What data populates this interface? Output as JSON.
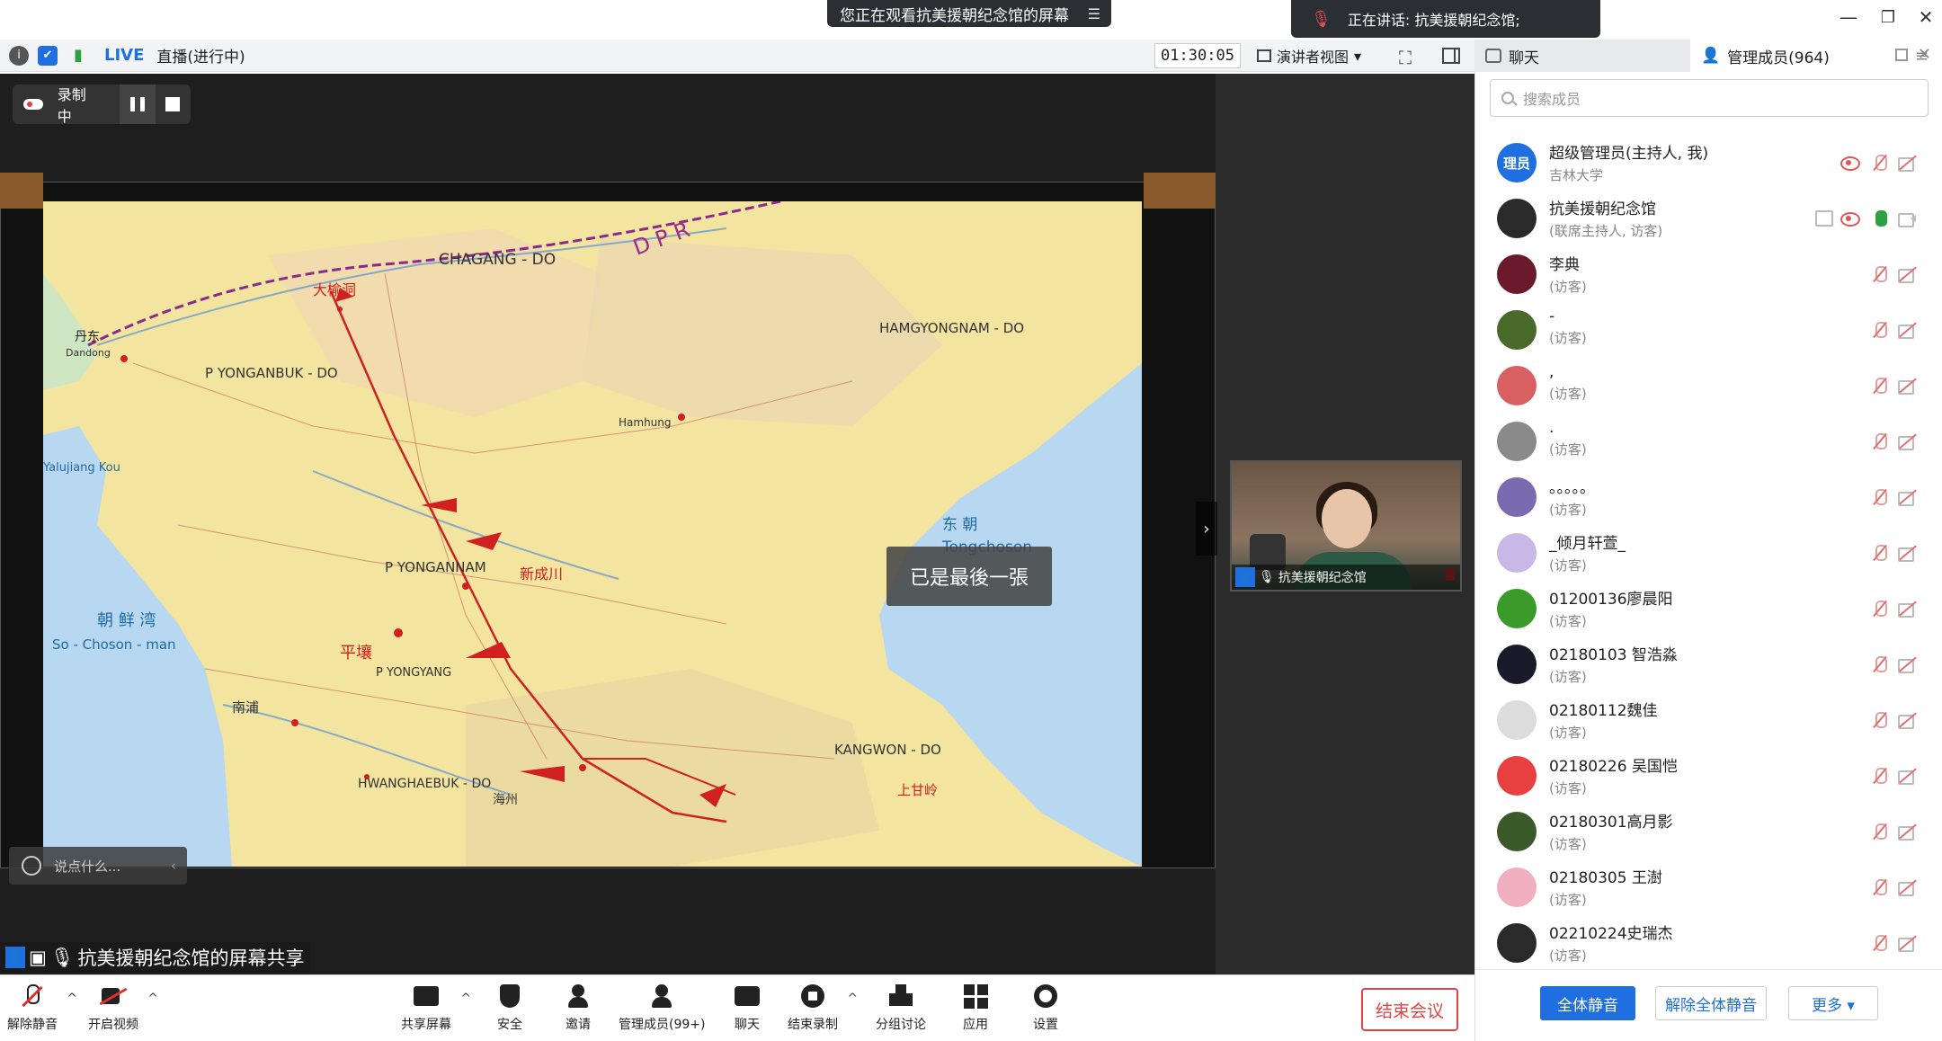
{
  "window": {
    "viewing_banner": "您正在观看抗美援朝纪念馆的屏幕",
    "speaking": "正在讲话: 抗美援朝纪念馆;",
    "min": "—",
    "restore": "❐",
    "close": "✕"
  },
  "statusbar": {
    "live": "LIVE",
    "live_status": "直播(进行中)",
    "timer": "01:30:05",
    "view_mode": "演讲者视图"
  },
  "panel_tabs": {
    "chat": "聊天",
    "members": "管理成员(964)"
  },
  "recording": {
    "label": "录制中"
  },
  "share": {
    "toast": "已是最後一張",
    "chat_placeholder": "说点什么...",
    "share_label": "抗美援朝纪念馆的屏幕共享"
  },
  "video_tile": {
    "name": "抗美援朝纪念馆"
  },
  "map_labels": {
    "dandong": "丹东",
    "dandong_en": "Dandong",
    "chagang": "CHAGANG - DO",
    "dpr": "D P R",
    "yonganbuk": "P YONGANBUK - DO",
    "hamgyongnam": "HAMGYONGNAM - DO",
    "pyongannam": "P YONGANNAM",
    "sojosonman": "So - Choson - man",
    "pyongyang": "P YONGYANG",
    "hwanghaebuk": "HWANGHAEBUK - DO",
    "kangwon": "KANGWON - DO",
    "tongchoson": "Tongchoson",
    "yalujiang": "Yalujiang Kou",
    "hamhung": "Hamhung",
    "chosen_bay": "朝 鲜 湾",
    "east": "东    朝",
    "sinanju": "新成川",
    "dayudong": "大榆洞",
    "pingrang": "平壤",
    "shangganling": "上甘岭",
    "nampo": "南浦",
    "haeju": "海州"
  },
  "members": {
    "search_placeholder": "搜索成员",
    "list": [
      {
        "name": "超级管理员(主持人, 我)",
        "role": "吉林大学",
        "avatar_text": "理员",
        "avatar_color": "#1f6fe0",
        "share": false,
        "rec": true,
        "mic_on": false
      },
      {
        "name": "抗美援朝纪念馆",
        "role": "(联席主持人, 访客)",
        "avatar_text": "",
        "avatar_color": "#2a2a2a",
        "share": true,
        "rec": true,
        "mic_on": true
      },
      {
        "name": "李典",
        "role": "(访客)",
        "avatar_text": "",
        "avatar_color": "#6a1a2a",
        "share": false,
        "rec": false,
        "mic_on": false
      },
      {
        "name": "-",
        "role": "(访客)",
        "avatar_text": "",
        "avatar_color": "#4a6a2a",
        "share": false,
        "rec": false,
        "mic_on": false
      },
      {
        "name": ",",
        "role": "(访客)",
        "avatar_text": "",
        "avatar_color": "#d86060",
        "share": false,
        "rec": false,
        "mic_on": false
      },
      {
        "name": ".",
        "role": "(访客)",
        "avatar_text": "",
        "avatar_color": "#8a8a8a",
        "share": false,
        "rec": false,
        "mic_on": false
      },
      {
        "name": "。。。。。",
        "role": "(访客)",
        "avatar_text": "",
        "avatar_color": "#7a6ab0",
        "share": false,
        "rec": false,
        "mic_on": false
      },
      {
        "name": "_倾月轩萱_",
        "role": "(访客)",
        "avatar_text": "",
        "avatar_color": "#c8b8e8",
        "share": false,
        "rec": false,
        "mic_on": false
      },
      {
        "name": "01200136廖晨阳",
        "role": "(访客)",
        "avatar_text": "",
        "avatar_color": "#3a9a2a",
        "share": false,
        "rec": false,
        "mic_on": false
      },
      {
        "name": "02180103 智浩淼",
        "role": "(访客)",
        "avatar_text": "",
        "avatar_color": "#1a1a2a",
        "share": false,
        "rec": false,
        "mic_on": false
      },
      {
        "name": "02180112魏佳",
        "role": "(访客)",
        "avatar_text": "",
        "avatar_color": "#dcdcdc",
        "share": false,
        "rec": false,
        "mic_on": false
      },
      {
        "name": "02180226 吴国恺",
        "role": "(访客)",
        "avatar_text": "",
        "avatar_color": "#e84040",
        "share": false,
        "rec": false,
        "mic_on": false
      },
      {
        "name": "02180301高月影",
        "role": "(访客)",
        "avatar_text": "",
        "avatar_color": "#3a5a2a",
        "share": false,
        "rec": false,
        "mic_on": false
      },
      {
        "name": "02180305 王澍",
        "role": "(访客)",
        "avatar_text": "",
        "avatar_color": "#f0b0c0",
        "share": false,
        "rec": false,
        "mic_on": false
      },
      {
        "name": "02210224史瑞杰",
        "role": "(访客)",
        "avatar_text": "",
        "avatar_color": "#2a2a2a",
        "share": false,
        "rec": false,
        "mic_on": false
      }
    ],
    "mute_all": "全体静音",
    "unmute_all": "解除全体静音",
    "more": "更多 ▾"
  },
  "toolbar": {
    "unmute": "解除静音",
    "start_video": "开启视频",
    "share_screen": "共享屏幕",
    "security": "安全",
    "invite": "邀请",
    "manage_members": "管理成员(99+)",
    "chat": "聊天",
    "end_recording": "结束录制",
    "breakout": "分组讨论",
    "apps": "应用",
    "settings": "设置",
    "end_meeting": "结束会议"
  }
}
